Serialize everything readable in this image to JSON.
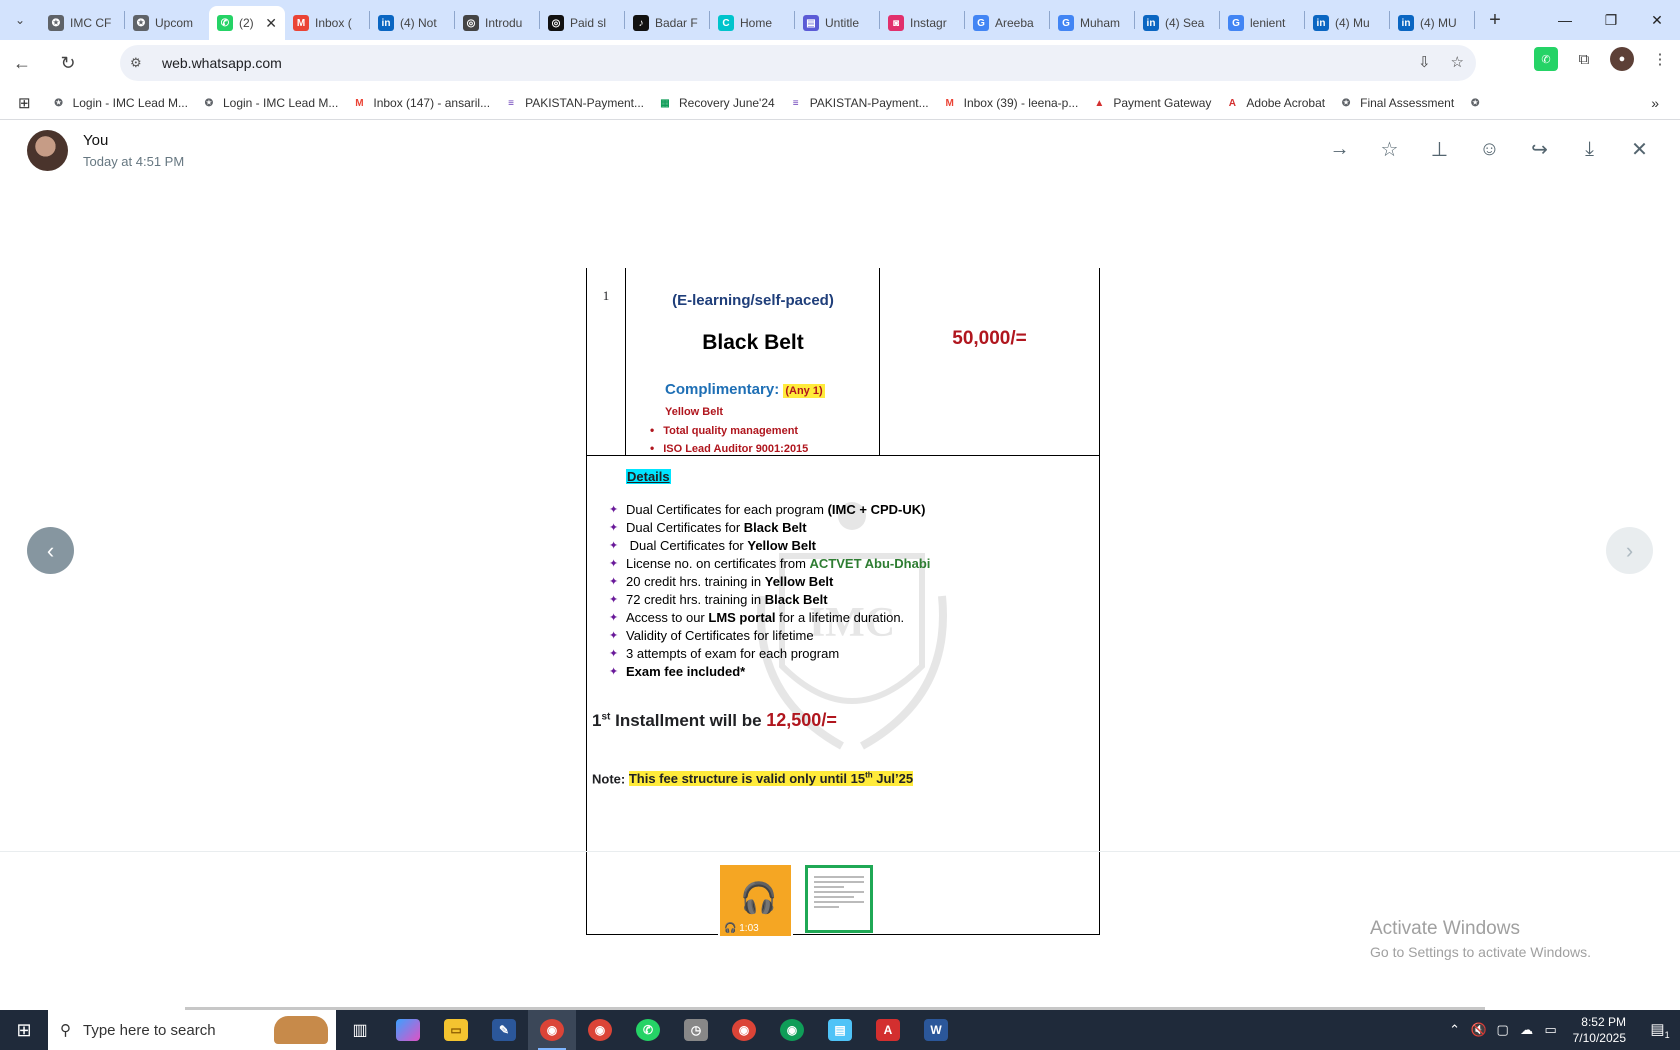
{
  "browser": {
    "tabs": [
      {
        "title": "IMC CF",
        "icon": "imc-icon",
        "color": "#5f6368"
      },
      {
        "title": "Upcom",
        "icon": "imc-icon",
        "color": "#5f6368"
      },
      {
        "title": "(2)",
        "icon": "whatsapp-icon",
        "color": "#25d366",
        "active": true
      },
      {
        "title": "Inbox (",
        "icon": "gmail-icon",
        "color": "#ea4335"
      },
      {
        "title": "(4) Not",
        "icon": "linkedin-icon",
        "color": "#0a66c2"
      },
      {
        "title": "Introdu",
        "icon": "chatgpt-icon",
        "color": "#444"
      },
      {
        "title": "Paid sl",
        "icon": "chatgpt-icon",
        "color": "#111"
      },
      {
        "title": "Badar F",
        "icon": "tiktok-icon",
        "color": "#111"
      },
      {
        "title": "Home",
        "icon": "canva-icon",
        "color": "#00c4cc"
      },
      {
        "title": "Untitle",
        "icon": "app-icon",
        "color": "#5b5bd6"
      },
      {
        "title": "Instagr",
        "icon": "instagram-icon",
        "color": "#e1306c"
      },
      {
        "title": "Areeba",
        "icon": "google-icon",
        "color": "#4285f4"
      },
      {
        "title": "Muham",
        "icon": "google-icon",
        "color": "#4285f4"
      },
      {
        "title": "(4) Sea",
        "icon": "linkedin-icon",
        "color": "#0a66c2"
      },
      {
        "title": "lenient",
        "icon": "google-icon",
        "color": "#4285f4"
      },
      {
        "title": "(4) Mu",
        "icon": "linkedin-icon",
        "color": "#0a66c2"
      },
      {
        "title": "(4) MU",
        "icon": "linkedin-icon",
        "color": "#0a66c2"
      }
    ],
    "url": "web.whatsapp.com",
    "bookmarks": [
      {
        "label": "Login - IMC Lead M...",
        "icon": "imc-icon",
        "color": "#5f6368"
      },
      {
        "label": "Login - IMC Lead M...",
        "icon": "imc-icon",
        "color": "#5f6368"
      },
      {
        "label": "Inbox (147) - ansaril...",
        "icon": "gmail-icon",
        "color": "#ea4335"
      },
      {
        "label": "PAKISTAN-Payment...",
        "icon": "form-icon",
        "color": "#673ab7"
      },
      {
        "label": "Recovery June'24",
        "icon": "sheets-icon",
        "color": "#0f9d58"
      },
      {
        "label": "PAKISTAN-Payment...",
        "icon": "form-icon",
        "color": "#673ab7"
      },
      {
        "label": "Inbox (39) - leena-p...",
        "icon": "gmail-icon",
        "color": "#ea4335"
      },
      {
        "label": "Payment Gateway",
        "icon": "gateway-icon",
        "color": "#d32f2f"
      },
      {
        "label": "Adobe Acrobat",
        "icon": "acrobat-icon",
        "color": "#d32f2f"
      },
      {
        "label": "Final Assessment",
        "icon": "imc-icon",
        "color": "#5f6368"
      },
      {
        "label": "",
        "icon": "imc-icon",
        "color": "#5f6368"
      }
    ]
  },
  "viewer": {
    "sender": "You",
    "time": "Today at 4:51 PM"
  },
  "doc": {
    "row_num": "1",
    "elearning": "(E-learning/self-paced)",
    "program": "Black Belt",
    "fee": "50,000/=",
    "complimentary_label": "Complimentary:",
    "any": "(Any 1)",
    "yellow_belt": "Yellow Belt",
    "bullets": [
      "Total quality management",
      "ISO Lead Auditor 9001:2015"
    ],
    "details_heading": "Details",
    "details": [
      {
        "a": "Dual Certificates for each program ",
        "b": "(IMC + CPD-UK)",
        "c": ""
      },
      {
        "a": "Dual Certificates for ",
        "b": "Black Belt",
        "c": ""
      },
      {
        "a": " Dual Certificates for ",
        "b": "Yellow Belt",
        "c": ""
      },
      {
        "a": "License no. on certificates from ",
        "g": "ACTVET Abu-Dhabi",
        "c": ""
      },
      {
        "a": "20 credit hrs. training in ",
        "b": "Yellow Belt",
        "c": ""
      },
      {
        "a": "72 credit hrs. training in ",
        "b": "Black Belt",
        "c": ""
      },
      {
        "a": "Access to our ",
        "b": "LMS portal",
        "c": " for a lifetime duration."
      },
      {
        "a": "Validity of Certificates for lifetime",
        "c": ""
      },
      {
        "a": "3 attempts of exam for each program",
        "c": ""
      },
      {
        "a": "",
        "b": "Exam fee included*",
        "c": ""
      }
    ],
    "installment_prefix": "1",
    "installment_sup": "st",
    "installment_text": "Installment will be",
    "installment_amount": "12,500/=",
    "note_label": "Note:",
    "note_text": "This fee structure is valid only until 15",
    "note_sup": "th",
    "note_tail": " Jul’25"
  },
  "thumbs": {
    "audio_duration": "1:03"
  },
  "watermark": {
    "line1": "Activate Windows",
    "line2": "Go to Settings to activate Windows."
  },
  "taskbar": {
    "search_placeholder": "Type here to search",
    "time": "8:52 PM",
    "date": "7/10/2025",
    "notifications": "1"
  }
}
